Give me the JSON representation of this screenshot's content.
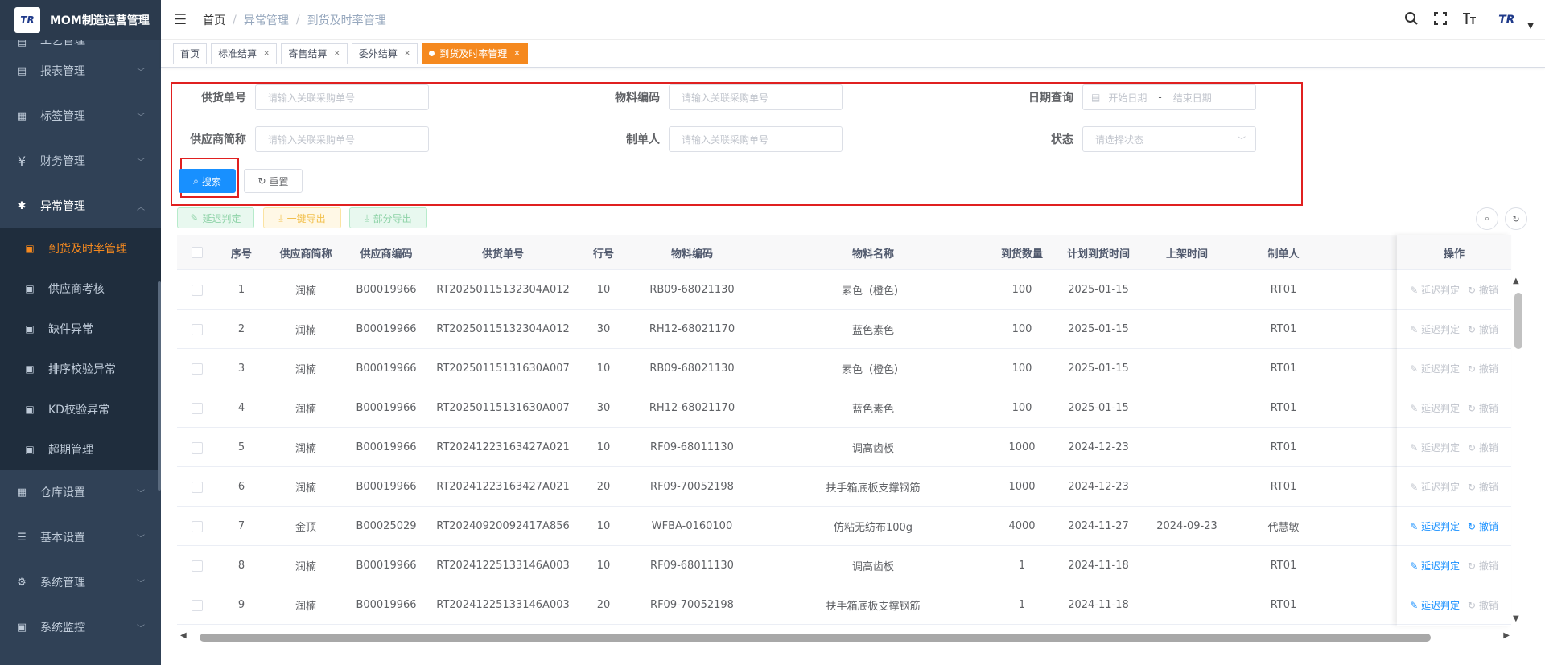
{
  "app": {
    "logo_text": "TR",
    "title": "MOM制造运营管理"
  },
  "sidebar": {
    "top_partial": {
      "label": "工艺管理",
      "icon": "process-icon"
    },
    "items_before": [
      {
        "label": "报表管理",
        "icon": "report-icon"
      },
      {
        "label": "标签管理",
        "icon": "grid-icon"
      },
      {
        "label": "财务管理",
        "icon": "yen-icon"
      }
    ],
    "open_item": {
      "label": "异常管理",
      "icon": "bug-icon"
    },
    "sub_items": [
      {
        "label": "到货及时率管理",
        "icon": "chart-icon",
        "active": true
      },
      {
        "label": "供应商考核",
        "icon": "chart-icon"
      },
      {
        "label": "缺件异常",
        "icon": "chart-icon"
      },
      {
        "label": "排序校验异常",
        "icon": "chart-icon"
      },
      {
        "label": "KD校验异常",
        "icon": "chart-icon"
      },
      {
        "label": "超期管理",
        "icon": "chart-icon"
      }
    ],
    "items_after": [
      {
        "label": "仓库设置",
        "icon": "grid-icon"
      },
      {
        "label": "基本设置",
        "icon": "sliders-icon"
      },
      {
        "label": "系统管理",
        "icon": "gear-icon"
      },
      {
        "label": "系统监控",
        "icon": "monitor-icon"
      }
    ]
  },
  "header": {
    "breadcrumb": [
      "首页",
      "异常管理",
      "到货及时率管理"
    ],
    "avatar_text": "TR"
  },
  "tags": [
    {
      "label": "首页",
      "closable": false
    },
    {
      "label": "标准结算",
      "closable": true
    },
    {
      "label": "寄售结算",
      "closable": true
    },
    {
      "label": "委外结算",
      "closable": true
    },
    {
      "label": "到货及时率管理",
      "closable": true,
      "active": true
    }
  ],
  "form": {
    "supply_no": {
      "label": "供货单号",
      "placeholder": "请输入关联采购单号"
    },
    "material_code": {
      "label": "物料编码",
      "placeholder": "请输入关联采购单号"
    },
    "date_query": {
      "label": "日期查询",
      "start_placeholder": "开始日期",
      "separator": "-",
      "end_placeholder": "结束日期"
    },
    "supplier_short": {
      "label": "供应商简称",
      "placeholder": "请输入关联采购单号"
    },
    "creator": {
      "label": "制单人",
      "placeholder": "请输入关联采购单号"
    },
    "status": {
      "label": "状态",
      "placeholder": "请选择状态"
    },
    "search_label": "搜索",
    "reset_label": "重置"
  },
  "toolbar": {
    "delay_judge": "延迟判定",
    "export_all": "一键导出",
    "export_partial": "部分导出"
  },
  "table": {
    "headers": [
      "序号",
      "供应商简称",
      "供应商编码",
      "供货单号",
      "行号",
      "物料编码",
      "物料名称",
      "到货数量",
      "计划到货时间",
      "上架时间",
      "制单人",
      "操作"
    ],
    "op_labels": {
      "judge": "延迟判定",
      "revoke": "撤销"
    },
    "rows": [
      {
        "idx": "1",
        "supplier": "润楠",
        "code": "B00019966",
        "order": "RT20250115132304A012",
        "line": "10",
        "material": "RB09-68021130",
        "name": "素色（橙色）",
        "qty": "100",
        "plan": "2025-01-15",
        "shelf": "",
        "creator": "RT01",
        "judge_enabled": false,
        "revoke_enabled": false
      },
      {
        "idx": "2",
        "supplier": "润楠",
        "code": "B00019966",
        "order": "RT20250115132304A012",
        "line": "30",
        "material": "RH12-68021170",
        "name": "蓝色素色",
        "qty": "100",
        "plan": "2025-01-15",
        "shelf": "",
        "creator": "RT01",
        "judge_enabled": false,
        "revoke_enabled": false
      },
      {
        "idx": "3",
        "supplier": "润楠",
        "code": "B00019966",
        "order": "RT20250115131630A007",
        "line": "10",
        "material": "RB09-68021130",
        "name": "素色（橙色）",
        "qty": "100",
        "plan": "2025-01-15",
        "shelf": "",
        "creator": "RT01",
        "judge_enabled": false,
        "revoke_enabled": false
      },
      {
        "idx": "4",
        "supplier": "润楠",
        "code": "B00019966",
        "order": "RT20250115131630A007",
        "line": "30",
        "material": "RH12-68021170",
        "name": "蓝色素色",
        "qty": "100",
        "plan": "2025-01-15",
        "shelf": "",
        "creator": "RT01",
        "judge_enabled": false,
        "revoke_enabled": false
      },
      {
        "idx": "5",
        "supplier": "润楠",
        "code": "B00019966",
        "order": "RT20241223163427A021",
        "line": "10",
        "material": "RF09-68011130",
        "name": "调高齿板",
        "qty": "1000",
        "plan": "2024-12-23",
        "shelf": "",
        "creator": "RT01",
        "judge_enabled": false,
        "revoke_enabled": false
      },
      {
        "idx": "6",
        "supplier": "润楠",
        "code": "B00019966",
        "order": "RT20241223163427A021",
        "line": "20",
        "material": "RF09-70052198",
        "name": "扶手箱底板支撑钢筋",
        "qty": "1000",
        "plan": "2024-12-23",
        "shelf": "",
        "creator": "RT01",
        "judge_enabled": false,
        "revoke_enabled": false
      },
      {
        "idx": "7",
        "supplier": "金顶",
        "code": "B00025029",
        "order": "RT20240920092417A856",
        "line": "10",
        "material": "WFBA-0160100",
        "name": "仿粘无纺布100g",
        "qty": "4000",
        "plan": "2024-11-27",
        "shelf": "2024-09-23",
        "creator": "代慧敏",
        "judge_enabled": true,
        "revoke_enabled": true
      },
      {
        "idx": "8",
        "supplier": "润楠",
        "code": "B00019966",
        "order": "RT20241225133146A003",
        "line": "10",
        "material": "RF09-68011130",
        "name": "调高齿板",
        "qty": "1",
        "plan": "2024-11-18",
        "shelf": "",
        "creator": "RT01",
        "judge_enabled": true,
        "revoke_enabled": false
      },
      {
        "idx": "9",
        "supplier": "润楠",
        "code": "B00019966",
        "order": "RT20241225133146A003",
        "line": "20",
        "material": "RF09-70052198",
        "name": "扶手箱底板支撑钢筋",
        "qty": "1",
        "plan": "2024-11-18",
        "shelf": "",
        "creator": "RT01",
        "judge_enabled": true,
        "revoke_enabled": false
      }
    ]
  },
  "colors": {
    "sidebar_bg": "#304156",
    "active_orange": "#f5891f",
    "primary_blue": "#1890ff",
    "highlight_red": "#e02020"
  }
}
